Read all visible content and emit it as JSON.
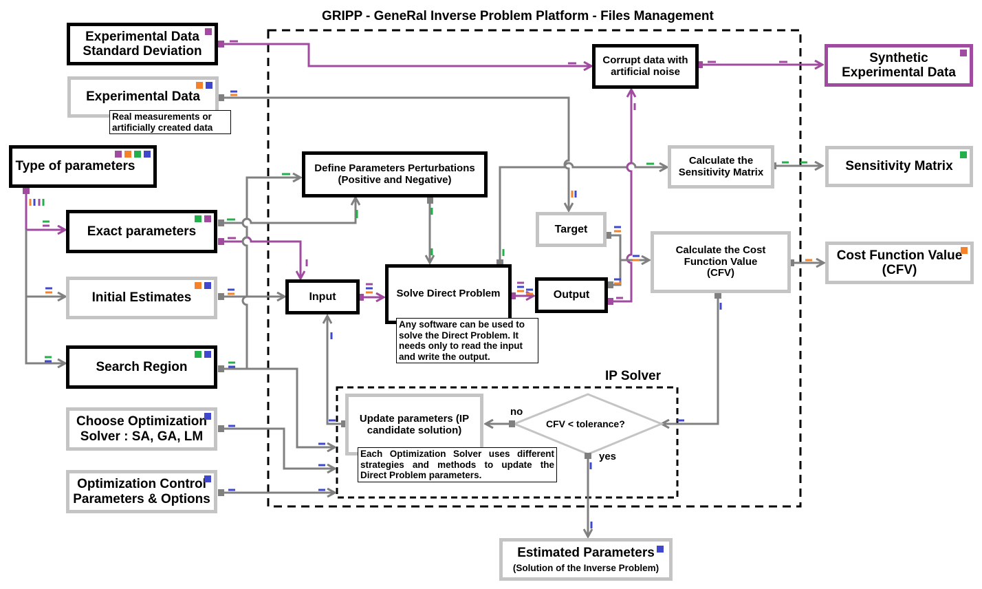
{
  "title": "GRIPP - GeneRal Inverse Problem Platform - Files Management",
  "ip_solver_label": "IP Solver",
  "colors": {
    "purple": "#a04aa0",
    "orange": "#f5822a",
    "green": "#23b04a",
    "blue": "#3f48cc",
    "gray_line": "#808080",
    "gray_border": "#c4c4c4"
  },
  "nodes": {
    "exp_std": {
      "label": "Experimental Data Standard Deviation",
      "tags": [
        "purple"
      ]
    },
    "exp_data": {
      "label": "Experimental Data",
      "tags": [
        "orange",
        "blue"
      ],
      "note": "Real measurements or artificially created data"
    },
    "type_params": {
      "label": "Type of parameters",
      "tags": [
        "purple",
        "orange",
        "green",
        "blue"
      ]
    },
    "exact_params": {
      "label": "Exact parameters",
      "tags": [
        "green",
        "purple"
      ]
    },
    "initial_estimates": {
      "label": "Initial Estimates",
      "tags": [
        "orange",
        "blue"
      ]
    },
    "search_region": {
      "label": "Search Region",
      "tags": [
        "green",
        "blue"
      ]
    },
    "choose_solver": {
      "label": "Choose Optimization Solver : SA, GA, LM",
      "tags": [
        "blue"
      ]
    },
    "opt_control": {
      "label": "Optimization Control Parameters & Options",
      "tags": [
        "blue"
      ]
    },
    "define_perturb": {
      "label": "Define Parameters Perturbations (Positive and Negative)"
    },
    "corrupt": {
      "label": "Corrupt data with artificial noise"
    },
    "synthetic": {
      "label": "Synthetic Experimental Data",
      "tags": [
        "purple"
      ]
    },
    "calc_sens": {
      "label": "Calculate the Sensitivity Matrix"
    },
    "sens_matrix": {
      "label": "Sensitivity Matrix",
      "tags": [
        "green"
      ]
    },
    "target": {
      "label": "Target"
    },
    "input": {
      "label": "Input"
    },
    "solve_direct": {
      "label": "Solve Direct Problem",
      "note": "Any software can be used to solve the Direct Problem. It needs only to read the input and write the output."
    },
    "output": {
      "label": "Output"
    },
    "calc_cfv": {
      "label": "Calculate the Cost Function Value (CFV)"
    },
    "cfv": {
      "label": "Cost Function Value (CFV)",
      "tags": [
        "orange"
      ]
    },
    "update_params": {
      "label": "Update parameters (IP candidate solution)",
      "note": "Each Optimization Solver uses different strategies and methods to update the Direct Problem parameters."
    },
    "decision": {
      "label": "CFV < tolerance?",
      "no": "no",
      "yes": "yes"
    },
    "estimated": {
      "label": "Estimated Parameters",
      "sublabel": "(Solution of the Inverse Problem)",
      "tags": [
        "blue"
      ]
    }
  }
}
